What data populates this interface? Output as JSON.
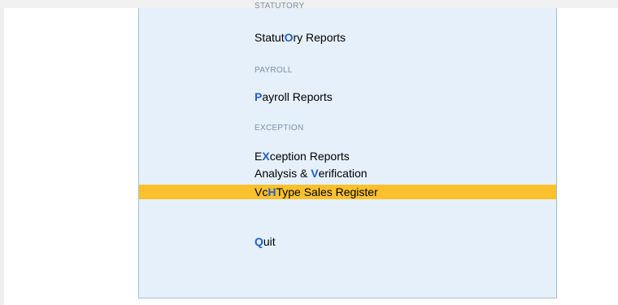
{
  "menu": {
    "section_statutory": "STATUTORY",
    "statutory_reports": {
      "a": "Statut",
      "key": "O",
      "b": "ry Reports"
    },
    "section_payroll": "PAYROLL",
    "payroll_reports": {
      "key": "P",
      "b": "ayroll Reports"
    },
    "section_exception": "EXCEPTION",
    "exception_reports": {
      "a": "E",
      "key": "X",
      "b": "ception Reports"
    },
    "analysis_verification": {
      "a": "Analysis & ",
      "key": "V",
      "b": "erification"
    },
    "vchtype_sales_register": {
      "a": "Vc",
      "key": "H",
      "b": "Type Sales Register"
    },
    "quit": {
      "key": "Q",
      "b": "uit"
    }
  },
  "colors": {
    "panel_background": "#e6f0fa",
    "selected_highlight": "#fbc12c",
    "hotkey": "#1f5fc6"
  }
}
